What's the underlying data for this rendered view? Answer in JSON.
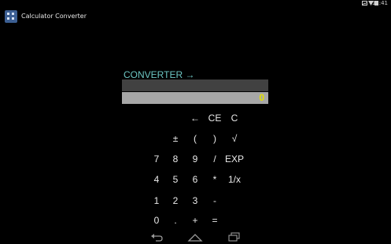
{
  "status_bar": {
    "time": "11:41"
  },
  "app": {
    "title": "Calculator Converter"
  },
  "converter": {
    "label": "CONVERTER →"
  },
  "display": {
    "expression": "",
    "value": "0"
  },
  "keypad": {
    "row1": [
      "←",
      "CE",
      "C"
    ],
    "row2": [
      "±",
      "(",
      ")",
      "√"
    ],
    "row3": [
      "7",
      "8",
      "9",
      "/",
      "EXP"
    ],
    "row4": [
      "4",
      "5",
      "6",
      "*",
      "1/x"
    ],
    "row5": [
      "1",
      "2",
      "3",
      "-"
    ],
    "row6": [
      "0",
      ".",
      "+",
      "="
    ]
  },
  "nav_icons": [
    "back-icon",
    "home-icon",
    "recent-apps-icon"
  ]
}
